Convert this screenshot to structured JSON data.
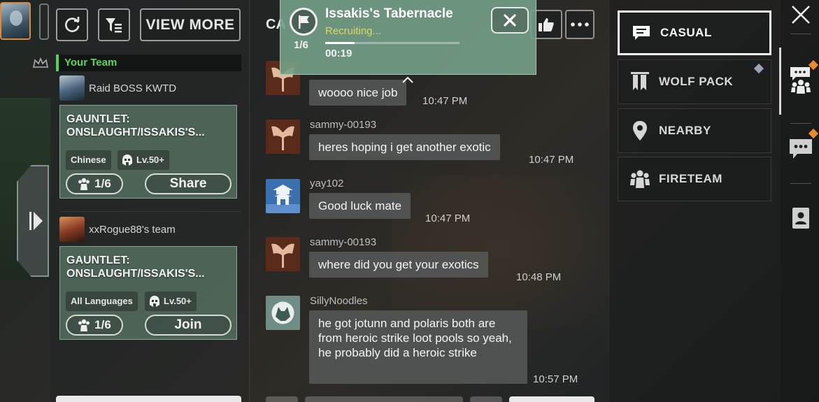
{
  "team_panel": {
    "view_more_label": "VIEW MORE",
    "your_team_label": "Your Team",
    "teams": [
      {
        "leader": "Raid BOSS KWTD",
        "title": "GAUNTLET: ONSLAUGHT/ISSAKIS'S...",
        "language": "Chinese",
        "level": "Lv.50+",
        "count": "1/6",
        "action": "Share"
      },
      {
        "leader": "xxRogue88's team",
        "title": "GAUNTLET: ONSLAUGHT/ISSAKIS'S...",
        "language": "All Languages",
        "level": "Lv.50+",
        "count": "1/6",
        "action": "Join"
      }
    ]
  },
  "chat": {
    "header_label": "CA",
    "messages": [
      {
        "sender": "",
        "text": "woooo nice job",
        "time": "10:47 PM"
      },
      {
        "sender": "sammy-00193",
        "text": "heres hoping i get another exotic",
        "time": "10:47 PM"
      },
      {
        "sender": "yay102",
        "text": "Good luck mate",
        "time": "10:47 PM"
      },
      {
        "sender": "sammy-00193",
        "text": "where did you get your exotics",
        "time": "10:48 PM"
      },
      {
        "sender": "SillyNoodles",
        "text": "he got jotunn and polaris both are from heroic strike loot pools so yeah, he probably did a heroic strike",
        "time": "10:57 PM"
      }
    ]
  },
  "recruit": {
    "title": "Issakis's Tabernacle",
    "status": "Recruiting...",
    "count": "1/6",
    "timer": "00:19",
    "progress": 0.22
  },
  "channels": [
    {
      "label": "CASUAL",
      "icon": "chat-bubble-icon",
      "active": true
    },
    {
      "label": "WOLF PACK",
      "icon": "banner-icon",
      "active": false
    },
    {
      "label": "NEARBY",
      "icon": "location-pin-icon",
      "active": false
    },
    {
      "label": "FIRETEAM",
      "icon": "fireteam-icon",
      "active": false
    }
  ],
  "colors": {
    "accent_green": "#59d85e",
    "recruit_status": "#e2d760",
    "notification": "#e98a2e"
  }
}
